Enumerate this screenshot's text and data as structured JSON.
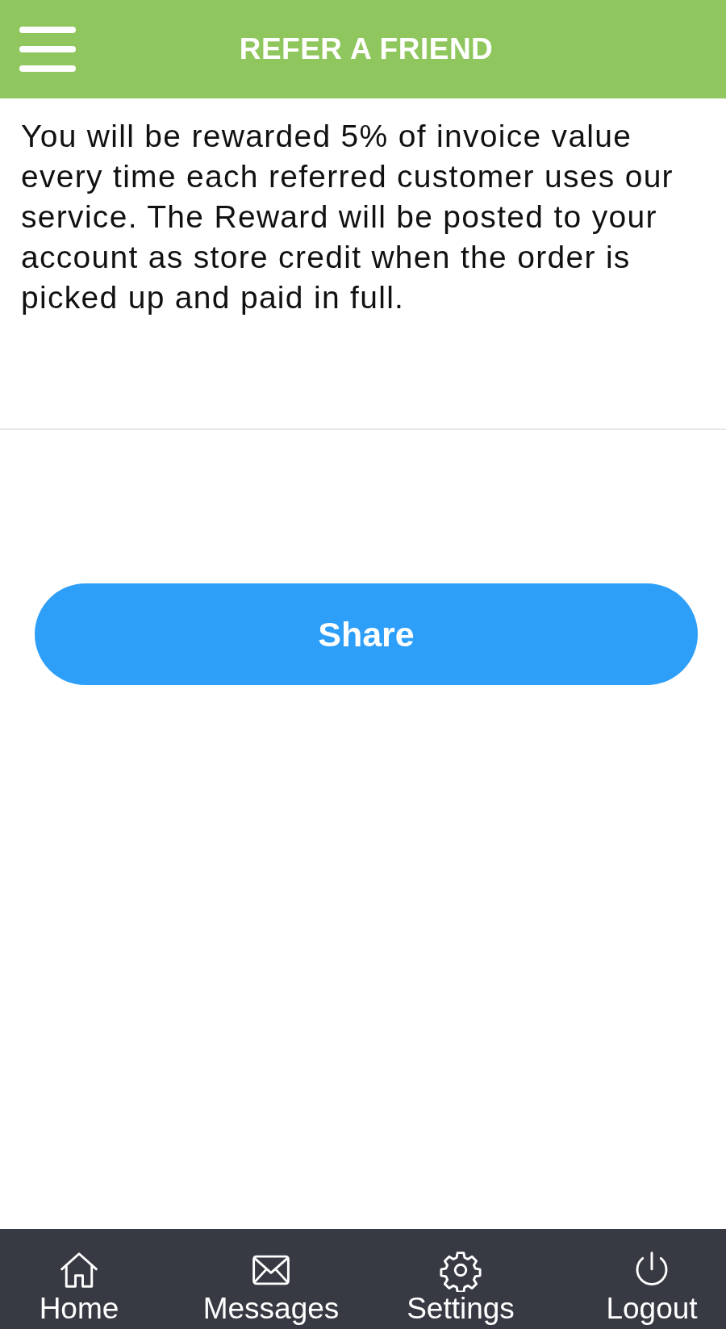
{
  "header": {
    "title": "REFER A FRIEND"
  },
  "description": "You will be rewarded 5% of invoice value every time each referred customer uses our service. The Reward will be posted to your account as store credit when the order is picked up and paid in full.",
  "share_button": {
    "label": "Share"
  },
  "tab_bar": [
    {
      "kind": "home",
      "label": "Home"
    },
    {
      "kind": "messages",
      "label": "Messages"
    },
    {
      "kind": "settings",
      "label": "Settings"
    },
    {
      "kind": "logout",
      "label": "Logout"
    }
  ]
}
